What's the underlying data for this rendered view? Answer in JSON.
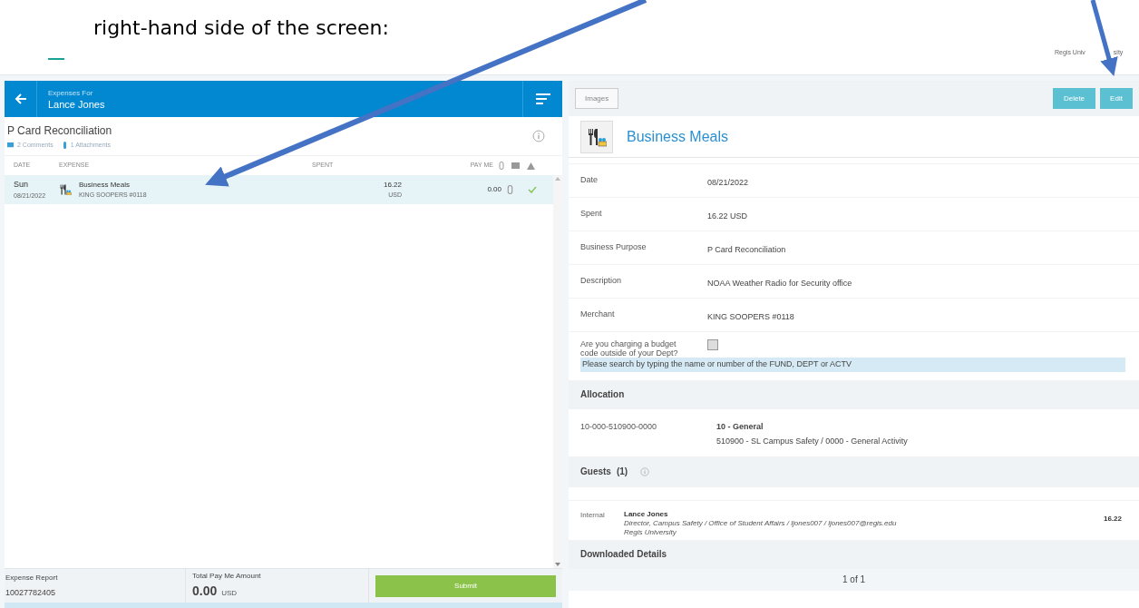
{
  "caption": "right-hand side of the screen:",
  "corner_text": [
    "Regis Univ",
    "sity"
  ],
  "left": {
    "header": {
      "subtitle": "Expenses For",
      "title": "Lance Jones"
    },
    "report_title": "P Card Reconciliation",
    "comments": "2 Comments",
    "attachments": "1 Attachments",
    "columns": [
      "DATE",
      "EXPENSE",
      "SPENT",
      "PAY ME"
    ],
    "rows": [
      {
        "day": "Sun",
        "date": "08/21/2022",
        "name": "Business Meals",
        "merchant": "KING SOOPERS #0118",
        "spent": "16.22",
        "currency": "USD",
        "pay_me": "0.00",
        "approved": true,
        "selected": true
      }
    ]
  },
  "footer": {
    "report_label": "Expense Report",
    "report_number": "10027782405",
    "total_label": "Total Pay Me Amount",
    "total": "0.00",
    "total_currency": "USD",
    "submit": "Submit"
  },
  "right": {
    "toolbar": {
      "images": "Images",
      "delete": "Delete",
      "edit": "Edit"
    },
    "title": "Business Meals",
    "fields": [
      {
        "kind": "text",
        "label": "Date",
        "value": "08/21/2022"
      },
      {
        "kind": "text",
        "label": "Spent",
        "value": "16.22 USD"
      },
      {
        "kind": "text",
        "label": "Business Purpose",
        "value": "P Card Reconciliation"
      },
      {
        "kind": "text",
        "label": "Description",
        "value": "NOAA Weather Radio for Security office"
      },
      {
        "kind": "text",
        "label": "Merchant",
        "value": "KING SOOPERS #0118"
      },
      {
        "kind": "checkbox",
        "label": "Are you charging a budget code outside of your Dept?",
        "checked": false
      }
    ],
    "search_hint": "Please search by typing the name or number of the FUND, DEPT or ACTV",
    "allocation": {
      "heading": "Allocation",
      "code": "10-000-510900-0000",
      "name": "10 - General",
      "detail": "510900 - SL Campus Safety / 0000 - General Activity"
    },
    "guests": {
      "heading": "Guests",
      "count": "(1)",
      "items": [
        {
          "type": "Internal",
          "name": "Lance Jones",
          "detail": "Director, Campus Safety / Office of Student Affairs / ljones007 / ljones007@regis.edu",
          "org": "Regis University",
          "amount": "16.22"
        }
      ]
    },
    "downloaded_heading": "Downloaded Details",
    "pagination": "1 of 1"
  }
}
